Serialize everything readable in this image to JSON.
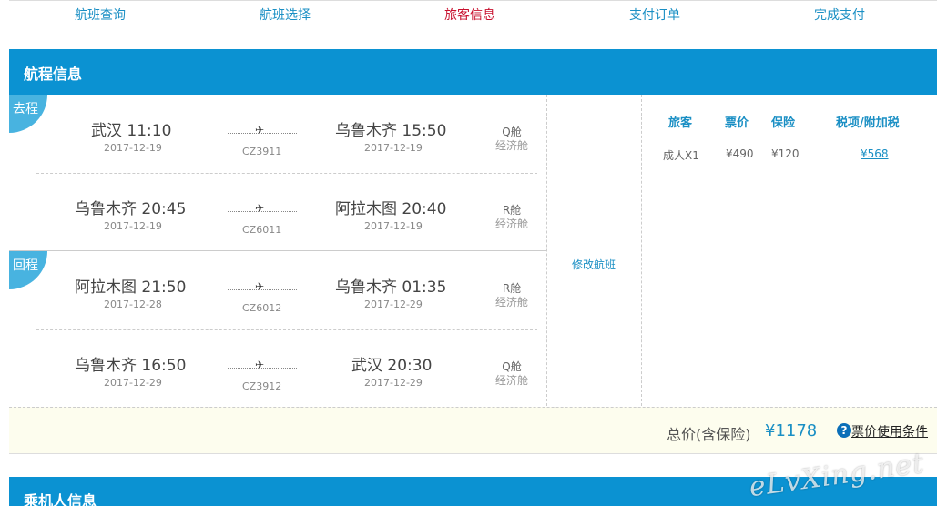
{
  "steps": [
    "航班查询",
    "航班选择",
    "旅客信息",
    "支付订单",
    "完成支付"
  ],
  "active_step": 2,
  "itinerary": {
    "title": "航程信息",
    "outbound_label": "去程",
    "return_label": "回程",
    "segments": [
      {
        "dep": "武汉  11:10",
        "dep_date": "2017-12-19",
        "arr": "乌鲁木齐  15:50",
        "arr_date": "2017-12-19",
        "flight": "CZ3911",
        "cabin": "Q舱",
        "cabin_class": "经济舱"
      },
      {
        "dep": "乌鲁木齐  20:45",
        "dep_date": "2017-12-19",
        "arr": "阿拉木图  20:40",
        "arr_date": "2017-12-19",
        "flight": "CZ6011",
        "cabin": "R舱",
        "cabin_class": "经济舱"
      },
      {
        "dep": "阿拉木图  21:50",
        "dep_date": "2017-12-28",
        "arr": "乌鲁木齐  01:35",
        "arr_date": "2017-12-29",
        "flight": "CZ6012",
        "cabin": "R舱",
        "cabin_class": "经济舱"
      },
      {
        "dep": "乌鲁木齐  16:50",
        "dep_date": "2017-12-29",
        "arr": "武汉  20:30",
        "arr_date": "2017-12-29",
        "flight": "CZ3912",
        "cabin": "Q舱",
        "cabin_class": "经济舱"
      }
    ],
    "modify_label": "修改航班"
  },
  "fare_table": {
    "headers": [
      "旅客",
      "票价",
      "保险",
      "税项/附加税"
    ],
    "row": [
      "成人X1",
      "¥490",
      "¥120",
      "¥568"
    ]
  },
  "total": {
    "label": "总价(含保险)",
    "value": "¥1178"
  },
  "help_icon": "question-icon",
  "rules_link": "票价使用条件",
  "passenger_section_title": "乘机人信息",
  "watermark": "eLvXing.net",
  "colors": {
    "banner": "#0b92d2",
    "link": "#1a8fc4",
    "active_step": "#c8102e",
    "badge": "#48b3e0"
  }
}
